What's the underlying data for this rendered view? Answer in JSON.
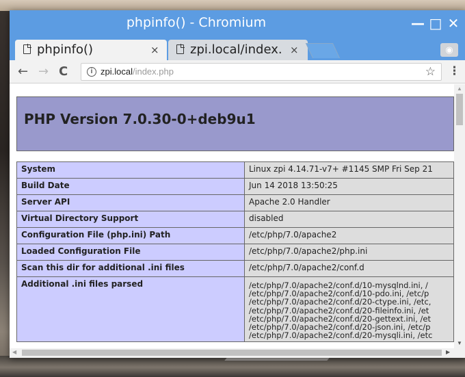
{
  "window": {
    "title": "phpinfo() - Chromium",
    "minimize_glyph": "—",
    "maximize_glyph": "□",
    "close_glyph": "✕"
  },
  "tabs": [
    {
      "label": "phpinfo()",
      "close": "×",
      "active": true
    },
    {
      "label": "zpi.local/index.",
      "close": "×",
      "active": false
    }
  ],
  "toolbar": {
    "back_icon": "←",
    "forward_icon": "→",
    "reload_icon": "C",
    "info_icon": "i",
    "url_host": "zpi.local",
    "url_path": "/index.php",
    "bookmark_icon": "☆",
    "menu_icon": "⋮"
  },
  "page": {
    "heading": "PHP Version 7.0.30-0+deb9u1",
    "rows": [
      {
        "key": "System",
        "value": "Linux zpi 4.14.71-v7+ #1145 SMP Fri Sep 21"
      },
      {
        "key": "Build Date",
        "value": "Jun 14 2018 13:50:25"
      },
      {
        "key": "Server API",
        "value": "Apache 2.0 Handler"
      },
      {
        "key": "Virtual Directory Support",
        "value": "disabled"
      },
      {
        "key": "Configuration File (php.ini) Path",
        "value": "/etc/php/7.0/apache2"
      },
      {
        "key": "Loaded Configuration File",
        "value": "/etc/php/7.0/apache2/php.ini"
      },
      {
        "key": "Scan this dir for additional .ini files",
        "value": "/etc/php/7.0/apache2/conf.d"
      },
      {
        "key": "Additional .ini files parsed",
        "lines": [
          "/etc/php/7.0/apache2/conf.d/10-mysqlnd.ini, /",
          "/etc/php/7.0/apache2/conf.d/10-pdo.ini, /etc/p",
          "/etc/php/7.0/apache2/conf.d/20-ctype.ini, /etc,",
          "/etc/php/7.0/apache2/conf.d/20-fileinfo.ini, /et",
          "/etc/php/7.0/apache2/conf.d/20-gettext.ini, /et",
          "/etc/php/7.0/apache2/conf.d/20-json.ini, /etc/p",
          "/etc/php/7.0/apache2/conf.d/20-mysqli.ini, /etc"
        ]
      }
    ]
  },
  "colors": {
    "titlebar": "#5c9ce2",
    "php_header": "#9999cc",
    "key_cell": "#ccccff",
    "value_cell": "#dddddd"
  }
}
